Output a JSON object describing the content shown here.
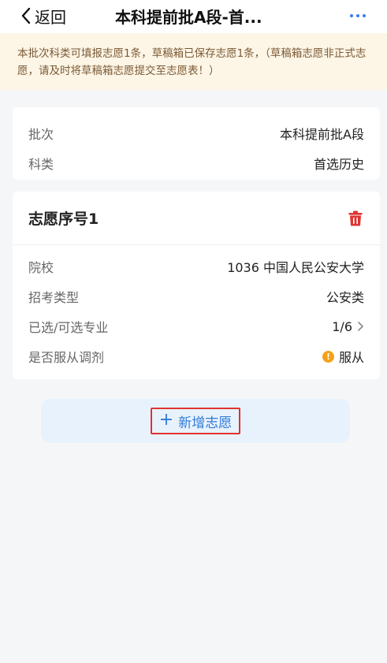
{
  "nav": {
    "back_label": "返回",
    "title": "本科提前批A段-首..."
  },
  "notice": {
    "text": "本批次科类可填报志愿1条，草稿箱已保存志愿1条，（草稿箱志愿非正式志愿，请及时将草稿箱志愿提交至志愿表！）"
  },
  "batch": {
    "batch_label": "批次",
    "batch_value": "本科提前批A段",
    "category_label": "科类",
    "category_value": "首选历史"
  },
  "choice": {
    "title": "志愿序号1",
    "school_label": "院校",
    "school_value": "1036 中国人民公安大学",
    "exam_type_label": "招考类型",
    "exam_type_value": "公安类",
    "major_label": "已选/可选专业",
    "major_value": "1/6",
    "adjust_label": "是否服从调剂",
    "adjust_value": "服从",
    "adjust_badge": "!"
  },
  "actions": {
    "add_label": "新增志愿",
    "add_plus": "+"
  },
  "colors": {
    "accent": "#2f7ad8",
    "notice_bg": "#fdf5e6",
    "delete": "#e0332f",
    "warn": "#f5a01a"
  }
}
